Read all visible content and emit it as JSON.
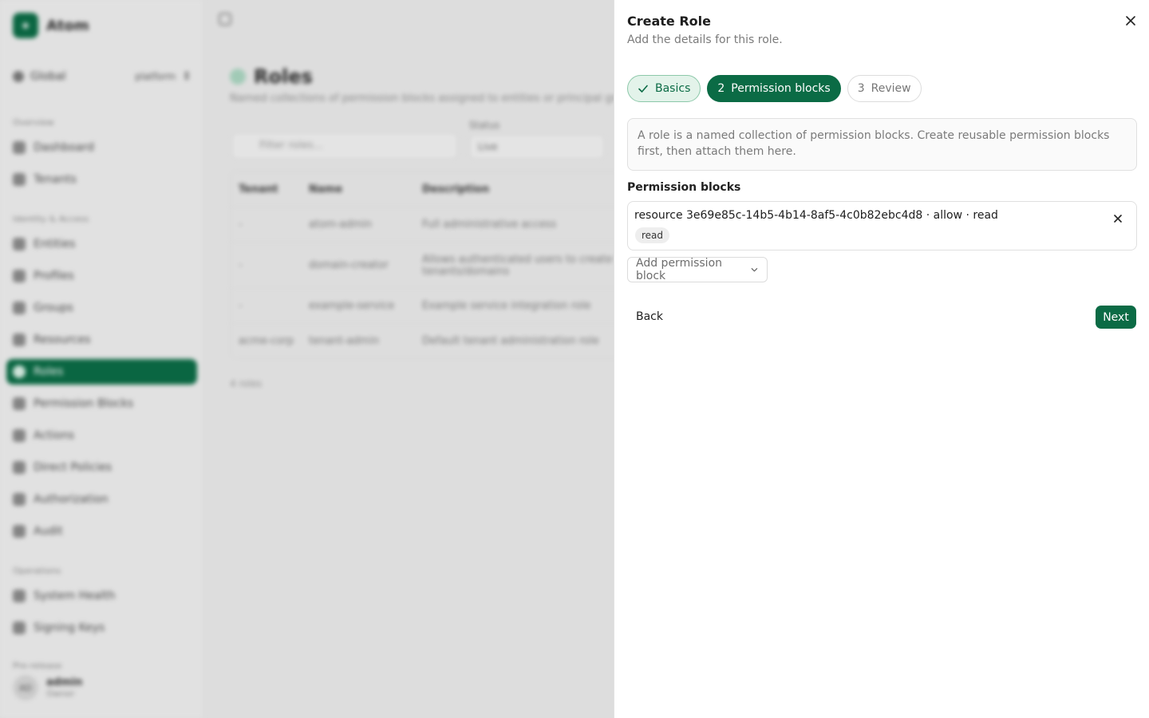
{
  "app": {
    "brand": "Atom",
    "scope": {
      "label": "Global",
      "value": "platform"
    },
    "sections": [
      "Overview",
      "Identity & Access",
      "Operations",
      "Pre-release"
    ],
    "nav": [
      {
        "label": "Dashboard"
      },
      {
        "label": "Tenants"
      },
      {
        "label": "Entities"
      },
      {
        "label": "Profiles"
      },
      {
        "label": "Groups"
      },
      {
        "label": "Resources"
      },
      {
        "label": "Roles",
        "active": true
      },
      {
        "label": "Permission Blocks"
      },
      {
        "label": "Actions"
      },
      {
        "label": "Direct Policies"
      },
      {
        "label": "Authorization"
      },
      {
        "label": "Audit"
      },
      {
        "label": "System Health"
      },
      {
        "label": "Signing Keys"
      }
    ],
    "user": {
      "initials": "AD",
      "name": "admin",
      "role": "Owner"
    }
  },
  "page": {
    "title": "Roles",
    "subtitle": "Named collections of permission blocks assigned to entities or principal groups.",
    "filter_placeholder": "Filter roles...",
    "status_label": "Status",
    "status_value": "Live",
    "columns": [
      "Tenant",
      "Name",
      "Description"
    ],
    "rows": [
      {
        "tenant": "-",
        "name": "atom-admin",
        "description": "Full administrative access"
      },
      {
        "tenant": "-",
        "name": "domain-creator",
        "description": "Allows authenticated users to create their own tenants/domains"
      },
      {
        "tenant": "-",
        "name": "example-service",
        "description": "Example service integration role"
      },
      {
        "tenant": "acme-corp",
        "name": "tenant-admin",
        "description": "Default tenant administration role"
      }
    ],
    "count": "4 roles"
  },
  "panel": {
    "title": "Create Role",
    "subtitle": "Add the details for this role.",
    "steps": [
      {
        "number": "",
        "label": "Basics",
        "state": "done"
      },
      {
        "number": "2",
        "label": "Permission blocks",
        "state": "current"
      },
      {
        "number": "3",
        "label": "Review",
        "state": "todo"
      }
    ],
    "info": "A role is a named collection of permission blocks. Create reusable permission blocks first, then attach them here.",
    "field_label": "Permission blocks",
    "blocks": [
      {
        "text": "resource 3e69e85c-14b5-4b14-8af5-4c0b82ebc4d8 · allow · read",
        "tag": "read"
      }
    ],
    "add_label": "Add permission block",
    "back_label": "Back",
    "next_label": "Next"
  },
  "colors": {
    "accent": "#0b6b45",
    "accent_light": "#e3f3ea"
  }
}
